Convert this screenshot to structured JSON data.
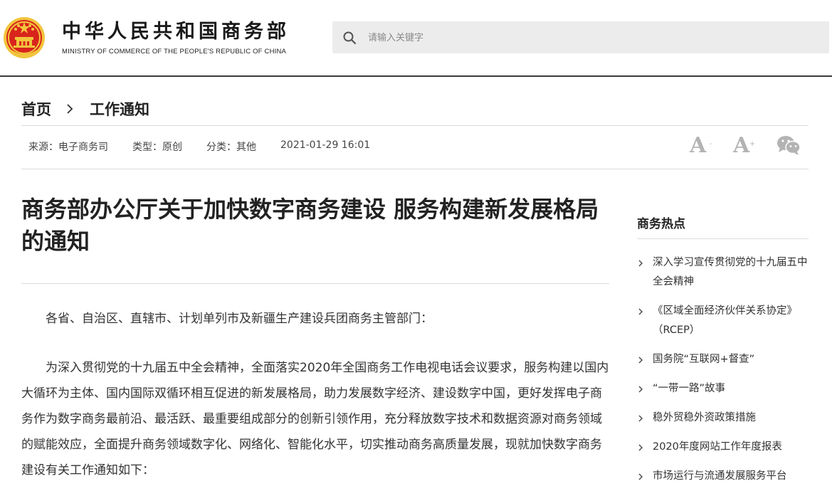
{
  "header": {
    "org_name_cn": "中华人民共和国商务部",
    "org_name_en": "MINISTRY OF COMMERCE OF THE PEOPLE'S REPUBLIC OF CHINA",
    "search_placeholder": "请输入关键字"
  },
  "breadcrumb": {
    "home": "首页",
    "current": "工作通知"
  },
  "meta": {
    "source": "来源：电子商务司",
    "type": "类型：原创",
    "category": "分类：其他",
    "datetime": "2021-01-29 16:01"
  },
  "tools": {
    "font_small": "A",
    "font_small_sign": "-",
    "font_large": "A",
    "font_large_sign": "+"
  },
  "article": {
    "title": "商务部办公厅关于加快数字商务建设 服务构建新发展格局的通知",
    "salutation": "各省、自治区、直辖市、计划单列市及新疆生产建设兵团商务主管部门：",
    "paragraph_1": "为深入贯彻党的十九届五中全会精神，全面落实2020年全国商务工作电视电话会议要求，服务构建以国内大循环为主体、国内国际双循环相互促进的新发展格局，助力发展数字经济、建设数字中国，更好发挥电子商务作为数字商务最前沿、最活跃、最重要组成部分的创新引领作用，充分释放数字技术和数据资源对商务领域的赋能效应，全面提升商务领域数字化、网络化、智能化水平，切实推动商务高质量发展，现就加快数字商务建设有关工作通知如下："
  },
  "sidebar": {
    "title": "商务热点",
    "items": [
      {
        "label": "深入学习宣传贯彻党的十九届五中全会精神"
      },
      {
        "label": "《区域全面经济伙伴关系协定》（RCEP）"
      },
      {
        "label": "国务院“互联网+督查”"
      },
      {
        "label": "“一带一路”故事"
      },
      {
        "label": "稳外贸稳外资政策措施"
      },
      {
        "label": "2020年度网站工作年度报表"
      },
      {
        "label": "市场运行与流通发展服务平台"
      }
    ]
  },
  "colors": {
    "emblem_red": "#d8241c",
    "emblem_gold": "#f2c53d",
    "tool_gray": "#b3b3b3",
    "search_bg": "#ececec"
  },
  "icons": {
    "logo": "national-emblem-icon",
    "search": "search-icon",
    "breadcrumb_separator": "chevron-right-icon",
    "share": "wechat-icon",
    "list_bullet": "chevron-right-icon"
  }
}
